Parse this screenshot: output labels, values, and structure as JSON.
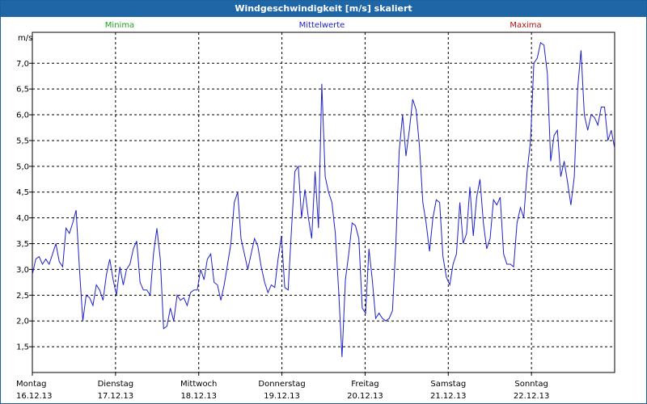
{
  "window": {
    "title": "Windgeschwindigkeit [m/s] skaliert"
  },
  "legend": [
    {
      "label": "Minima",
      "color": "#1fa31f"
    },
    {
      "label": "Mittelwerte",
      "color": "#2020c8"
    },
    {
      "label": "Maxima",
      "color": "#b01010"
    }
  ],
  "chart_data": {
    "type": "line",
    "ylabel": "m/s",
    "ylim": [
      1.0,
      7.6
    ],
    "y_ticks": [
      "1,5",
      "2,0",
      "2,5",
      "3,0",
      "3,5",
      "4,0",
      "4,5",
      "5,0",
      "5,5",
      "6,0",
      "6,5",
      "7,0"
    ],
    "y_tick_values": [
      1.5,
      2.0,
      2.5,
      3.0,
      3.5,
      4.0,
      4.5,
      5.0,
      5.5,
      6.0,
      6.5,
      7.0
    ],
    "xlim": [
      0,
      7
    ],
    "x_ticks": [
      {
        "day": "Montag",
        "date": "16.12.13"
      },
      {
        "day": "Dienstag",
        "date": "17.12.13"
      },
      {
        "day": "Mittwoch",
        "date": "18.12.13"
      },
      {
        "day": "Donnerstag",
        "date": "19.12.13"
      },
      {
        "day": "Freitag",
        "date": "20.12.13"
      },
      {
        "day": "Samstag",
        "date": "21.12.13"
      },
      {
        "day": "Sonntag",
        "date": "22.12.13"
      }
    ],
    "grid": true,
    "series": [
      {
        "name": "Mittelwerte",
        "color": "#2020c8",
        "x_step_per_day": 24,
        "values": [
          2.9,
          3.2,
          3.25,
          3.1,
          3.2,
          3.1,
          3.3,
          3.5,
          3.15,
          3.05,
          3.8,
          3.7,
          3.9,
          4.15,
          3.0,
          2.0,
          2.5,
          2.45,
          2.3,
          2.7,
          2.6,
          2.4,
          2.9,
          3.2,
          2.8,
          2.5,
          3.05,
          2.7,
          3.0,
          3.1,
          3.4,
          3.55,
          2.75,
          2.6,
          2.6,
          2.5,
          3.3,
          3.8,
          3.2,
          1.85,
          1.9,
          2.25,
          2.0,
          2.5,
          2.4,
          2.45,
          2.3,
          2.55,
          2.6,
          2.6,
          3.0,
          2.8,
          3.2,
          3.3,
          2.75,
          2.7,
          2.4,
          2.7,
          3.1,
          3.5,
          4.3,
          4.5,
          3.6,
          3.3,
          3.0,
          3.3,
          3.6,
          3.45,
          3.05,
          2.75,
          2.55,
          2.7,
          2.65,
          3.2,
          3.65,
          2.65,
          2.6,
          3.8,
          4.9,
          5.0,
          4.0,
          4.55,
          4.0,
          3.6,
          4.9,
          3.8,
          6.6,
          4.8,
          4.5,
          4.3,
          3.7,
          2.6,
          1.3,
          2.8,
          3.3,
          3.9,
          3.85,
          3.6,
          2.25,
          2.15,
          3.4,
          2.8,
          2.05,
          2.15,
          2.05,
          2.0,
          2.05,
          2.2,
          3.5,
          5.3,
          6.0,
          5.2,
          5.7,
          6.3,
          6.1,
          5.4,
          4.3,
          3.9,
          3.35,
          4.0,
          4.35,
          4.3,
          3.25,
          2.85,
          2.7,
          3.1,
          3.3,
          4.3,
          3.5,
          3.7,
          4.6,
          3.65,
          4.4,
          4.75,
          3.9,
          3.4,
          3.6,
          4.35,
          4.25,
          4.4,
          3.3,
          3.1,
          3.1,
          3.05,
          3.9,
          4.2,
          4.0,
          4.9,
          5.5,
          7.0,
          7.1,
          7.4,
          7.35,
          6.8,
          5.1,
          5.6,
          5.7,
          4.8,
          5.1,
          4.7,
          4.25,
          4.8,
          6.5,
          7.25,
          6.0,
          5.7,
          6.0,
          5.95,
          5.8,
          6.15,
          6.15,
          5.5,
          5.7,
          5.35
        ]
      }
    ]
  }
}
